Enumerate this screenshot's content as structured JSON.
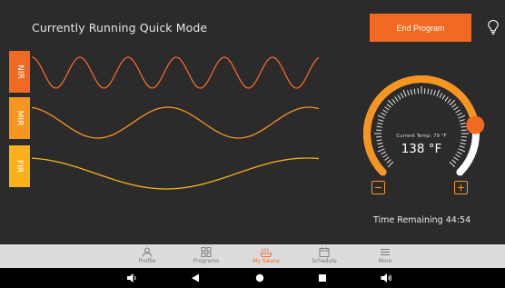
{
  "header": {
    "title": "Currently Running Quick Mode",
    "end_button": "End Program",
    "light_icon": "lightbulb-icon"
  },
  "channels": [
    {
      "label": "NIR",
      "color": "#f26a22"
    },
    {
      "label": "MIR",
      "color": "#f7951e"
    },
    {
      "label": "FIR",
      "color": "#fbb11a"
    }
  ],
  "temperature": {
    "label": "Current Temp: 79 °F",
    "value": "138 °F",
    "current": 79,
    "setpoint": 138,
    "minus_icon": "minus-icon",
    "plus_icon": "plus-icon"
  },
  "timer": {
    "text": "Time Remaining 44:54"
  },
  "nav": {
    "items": [
      {
        "label": "Profile",
        "icon": "person-icon"
      },
      {
        "label": "Programs",
        "icon": "grid-icon"
      },
      {
        "label": "My Sauna",
        "icon": "sauna-icon",
        "active": true
      },
      {
        "label": "Schedule",
        "icon": "calendar-icon"
      },
      {
        "label": "More",
        "icon": "menu-icon"
      }
    ]
  },
  "system_bar": {
    "buttons": [
      "volume-down-icon",
      "back-icon",
      "home-icon",
      "recents-icon",
      "volume-up-icon"
    ]
  },
  "colors": {
    "accent": "#f26a22",
    "mid": "#f7951e",
    "far": "#fbb11a",
    "background": "#2b2b2b"
  }
}
